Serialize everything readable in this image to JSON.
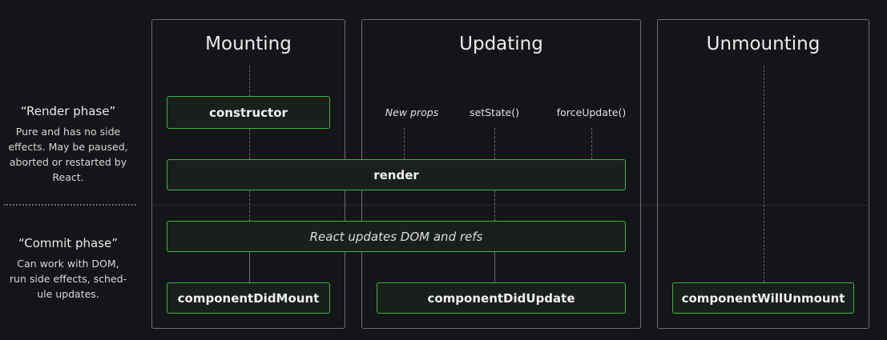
{
  "phases": {
    "render": {
      "title": "“Render phase”",
      "description": [
        "Pure and has no side",
        "effects. May be paused,",
        "aborted or restarted by",
        "React."
      ]
    },
    "commit": {
      "title": "“Commit phase”",
      "description": [
        "Can work with DOM,",
        "run side effects, sched-",
        "ule updates."
      ]
    }
  },
  "columns": {
    "mounting": "Mounting",
    "updating": "Updating",
    "unmounting": "Unmounting"
  },
  "triggers": {
    "new_props": "New props",
    "set_state": "setState()",
    "force_update": "forceUpdate()"
  },
  "boxes": {
    "constructor": "constructor",
    "render": "render",
    "dom_update": "React updates DOM and refs",
    "did_mount": "componentDidMount",
    "did_update": "componentDidUpdate",
    "will_unmount": "componentWillUnmount"
  },
  "colors": {
    "background": "#141518",
    "box_border": "#3cb34a",
    "box_fill": "#1a1f1b",
    "frame_border": "#6c6f75"
  }
}
